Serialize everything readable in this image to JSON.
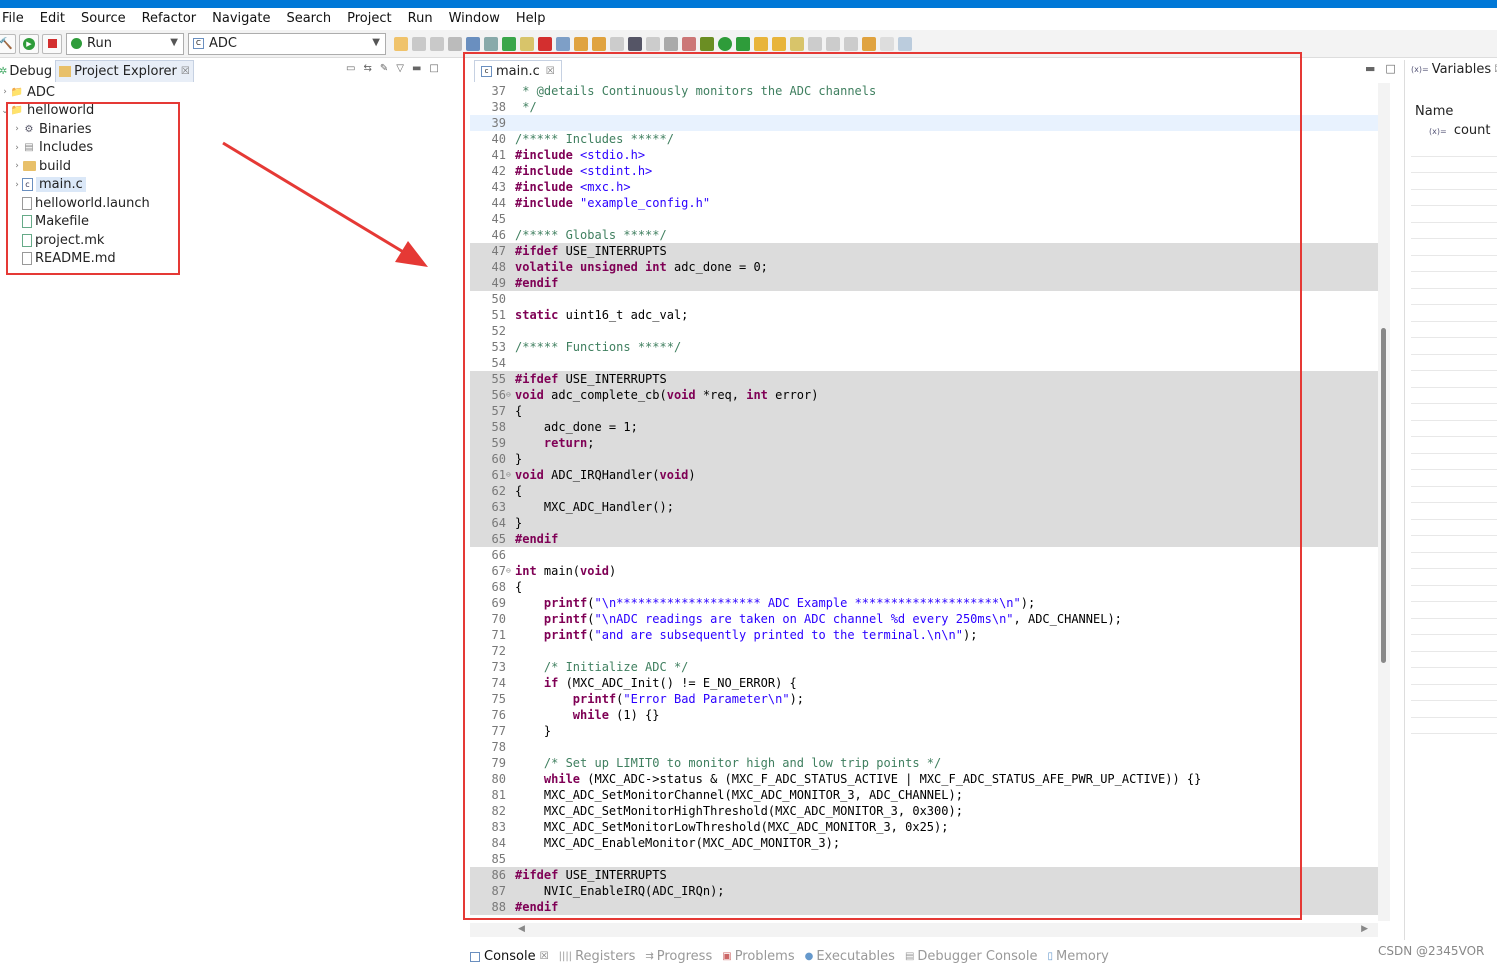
{
  "menu": [
    "File",
    "Edit",
    "Source",
    "Refactor",
    "Navigate",
    "Search",
    "Project",
    "Run",
    "Window",
    "Help"
  ],
  "toolbar": {
    "run_combo": "Run",
    "target_combo": "ADC"
  },
  "left_tabs": {
    "debug": "Debug",
    "project_explorer": "Project Explorer"
  },
  "tree": {
    "root1": "ADC",
    "root2": "helloworld",
    "children": [
      "Binaries",
      "Includes",
      "build",
      "main.c",
      "helloworld.launch",
      "Makefile",
      "project.mk",
      "README.md"
    ]
  },
  "editor": {
    "tab_label": "main.c",
    "lines": [
      {
        "n": "37",
        "t": " * @details Continuously monitors the ADC channels"
      },
      {
        "n": "38",
        "t": " */"
      },
      {
        "n": "39",
        "t": ""
      },
      {
        "n": "40",
        "t": "/***** Includes *****/"
      },
      {
        "n": "41",
        "t": "#include <stdio.h>"
      },
      {
        "n": "42",
        "t": "#include <stdint.h>"
      },
      {
        "n": "43",
        "t": "#include <mxc.h>"
      },
      {
        "n": "44",
        "t": "#include \"example_config.h\""
      },
      {
        "n": "45",
        "t": ""
      },
      {
        "n": "46",
        "t": "/***** Globals *****/"
      },
      {
        "n": "47",
        "t": "#ifdef USE_INTERRUPTS"
      },
      {
        "n": "48",
        "t": "volatile unsigned int adc_done = 0;"
      },
      {
        "n": "49",
        "t": "#endif"
      },
      {
        "n": "50",
        "t": ""
      },
      {
        "n": "51",
        "t": "static uint16_t adc_val;"
      },
      {
        "n": "52",
        "t": ""
      },
      {
        "n": "53",
        "t": "/***** Functions *****/"
      },
      {
        "n": "54",
        "t": ""
      },
      {
        "n": "55",
        "t": "#ifdef USE_INTERRUPTS"
      },
      {
        "n": "56",
        "t": "void adc_complete_cb(void *req, int error)"
      },
      {
        "n": "57",
        "t": "{"
      },
      {
        "n": "58",
        "t": "    adc_done = 1;"
      },
      {
        "n": "59",
        "t": "    return;"
      },
      {
        "n": "60",
        "t": "}"
      },
      {
        "n": "61",
        "t": "void ADC_IRQHandler(void)"
      },
      {
        "n": "62",
        "t": "{"
      },
      {
        "n": "63",
        "t": "    MXC_ADC_Handler();"
      },
      {
        "n": "64",
        "t": "}"
      },
      {
        "n": "65",
        "t": "#endif"
      },
      {
        "n": "66",
        "t": ""
      },
      {
        "n": "67",
        "t": "int main(void)"
      },
      {
        "n": "68",
        "t": "{"
      },
      {
        "n": "69",
        "t": "    printf(\"\\n******************** ADC Example ********************\\n\");"
      },
      {
        "n": "70",
        "t": "    printf(\"\\nADC readings are taken on ADC channel %d every 250ms\\n\", ADC_CHANNEL);"
      },
      {
        "n": "71",
        "t": "    printf(\"and are subsequently printed to the terminal.\\n\\n\");"
      },
      {
        "n": "72",
        "t": ""
      },
      {
        "n": "73",
        "t": "    /* Initialize ADC */"
      },
      {
        "n": "74",
        "t": "    if (MXC_ADC_Init() != E_NO_ERROR) {"
      },
      {
        "n": "75",
        "t": "        printf(\"Error Bad Parameter\\n\");"
      },
      {
        "n": "76",
        "t": "        while (1) {}"
      },
      {
        "n": "77",
        "t": "    }"
      },
      {
        "n": "78",
        "t": ""
      },
      {
        "n": "79",
        "t": "    /* Set up LIMIT0 to monitor high and low trip points */"
      },
      {
        "n": "80",
        "t": "    while (MXC_ADC->status & (MXC_F_ADC_STATUS_ACTIVE | MXC_F_ADC_STATUS_AFE_PWR_UP_ACTIVE)) {}"
      },
      {
        "n": "81",
        "t": "    MXC_ADC_SetMonitorChannel(MXC_ADC_MONITOR_3, ADC_CHANNEL);"
      },
      {
        "n": "82",
        "t": "    MXC_ADC_SetMonitorHighThreshold(MXC_ADC_MONITOR_3, 0x300);"
      },
      {
        "n": "83",
        "t": "    MXC_ADC_SetMonitorLowThreshold(MXC_ADC_MONITOR_3, 0x25);"
      },
      {
        "n": "84",
        "t": "    MXC_ADC_EnableMonitor(MXC_ADC_MONITOR_3);"
      },
      {
        "n": "85",
        "t": ""
      },
      {
        "n": "86",
        "t": "#ifdef USE_INTERRUPTS"
      },
      {
        "n": "87",
        "t": "    NVIC_EnableIRQ(ADC_IRQn);"
      },
      {
        "n": "88",
        "t": "#endif"
      }
    ]
  },
  "variables": {
    "tab": "Variables",
    "col_name": "Name",
    "row": "count"
  },
  "bottom_tabs": [
    "Console",
    "Registers",
    "Progress",
    "Problems",
    "Executables",
    "Debugger Console",
    "Memory"
  ],
  "watermark": "CSDN @2345VOR",
  "colors": {
    "highlight_box": "#e53935",
    "keyword": "#7f0055",
    "comment": "#3f7f5f",
    "string": "#2a00ff"
  }
}
